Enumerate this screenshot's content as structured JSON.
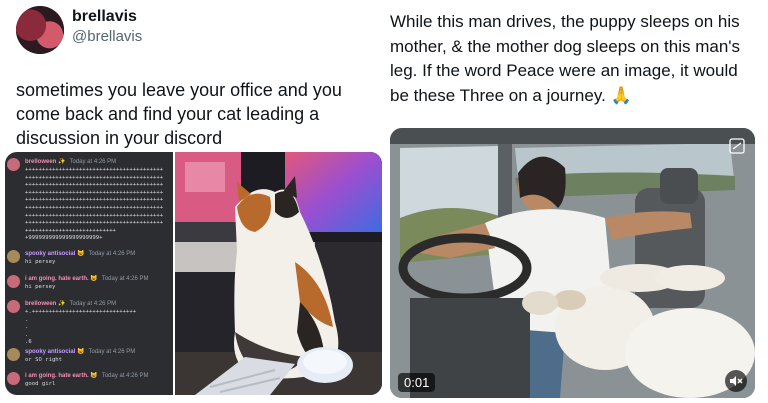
{
  "left_tweet": {
    "display_name": "brellavis",
    "handle": "@brellavis",
    "text": "sometimes you leave your office and you come back and find your cat leading a discussion in your discord",
    "discord": {
      "messages": [
        {
          "user": "brelloween ✨",
          "time": "Today at 4:26 PM",
          "body": "+++++++++++++++++++++++++++++++++++++++++\n+++++++++++++++++++++++++++++++++++++++++\n+++++++++++++++++++++++++++++++++++++++++\n+++++++++++++++++++++++++++++++++++++++++\n+++++++++++++++++++++++++++++++++++++++++\n+++++++++++++++++++++++++++++++++++++++++\n+++++++++++++++++++++++++++++++++++++++++\n+++++++++++++++++++++++++++++++++++++++++\n+++++++++++++++++++++++++++\n+999999999999999999999+",
          "color": "#f38fb2"
        },
        {
          "user": "spooky antisocial 😺",
          "time": "Today at 4:26 PM",
          "body": "hi persey",
          "color": "#c79bff"
        },
        {
          "user": "i am going. hate earth. 😺",
          "time": "Today at 4:26 PM",
          "body": "hi persey",
          "color": "#f38fb2"
        },
        {
          "user": "brelloween ✨",
          "time": "Today at 4:26 PM",
          "body": "+.+++++++++++++++++++++++++++++++\n.\n.\n.\n.6",
          "color": "#f38fb2"
        },
        {
          "user": "spooky antisocial 😺",
          "time": "Today at 4:26 PM",
          "body": "or SO right",
          "color": "#c79bff"
        },
        {
          "user": "i am going. hate earth. 😺",
          "time": "Today at 4:26 PM",
          "body": "good girl",
          "color": "#f38fb2"
        }
      ]
    }
  },
  "right_tweet": {
    "text": "While this man drives, the puppy sleeps on his mother, & the mother dog sleeps on this man's leg. If the word Peace were an image, it would be these Three on a journey. 🙏",
    "video_time": "0:01"
  }
}
